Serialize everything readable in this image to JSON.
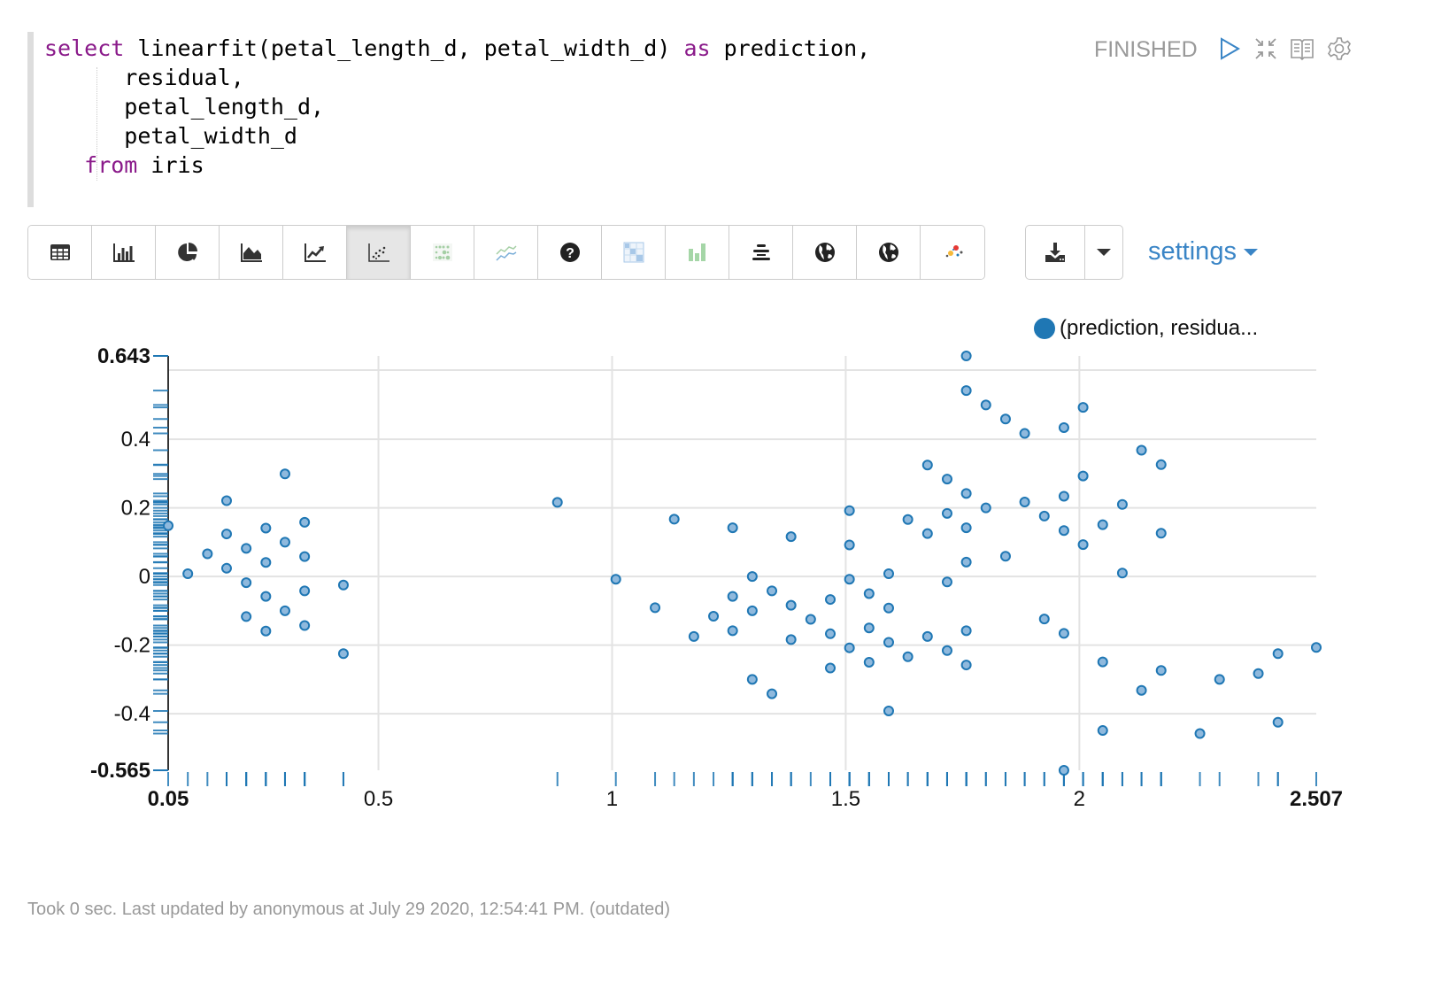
{
  "paragraph": {
    "code_lines": [
      [
        {
          "t": "select",
          "kw": true
        },
        {
          "t": " linearfit(petal_length_d, petal_width_d) "
        },
        {
          "t": "as",
          "kw": true
        },
        {
          "t": " prediction,"
        }
      ],
      [
        {
          "t": "      residual,"
        }
      ],
      [
        {
          "t": "      petal_length_d,"
        }
      ],
      [
        {
          "t": "      petal_width_d"
        }
      ],
      [
        {
          "t": "   "
        },
        {
          "t": "from",
          "kw": true
        },
        {
          "t": " iris"
        }
      ]
    ],
    "status": "FINISHED",
    "header_icons": [
      "run-icon",
      "collapse-icon",
      "book-icon",
      "gear-icon"
    ]
  },
  "toolbar": {
    "buttons": [
      {
        "name": "table-icon",
        "active": false
      },
      {
        "name": "bar-chart-icon",
        "active": false
      },
      {
        "name": "pie-chart-icon",
        "active": false
      },
      {
        "name": "area-chart-icon",
        "active": false
      },
      {
        "name": "line-chart-icon",
        "active": false
      },
      {
        "name": "scatter-chart-icon",
        "active": true
      },
      {
        "name": "bubble-grid-icon",
        "active": false
      },
      {
        "name": "multi-line-icon",
        "active": false
      },
      {
        "name": "help-icon",
        "active": false
      },
      {
        "name": "heatmap-icon",
        "active": false
      },
      {
        "name": "green-bar-icon",
        "active": false
      },
      {
        "name": "align-center-icon",
        "active": false
      },
      {
        "name": "globe-icon",
        "active": false
      },
      {
        "name": "globe-icon-2",
        "active": false
      },
      {
        "name": "color-scatter-icon",
        "active": false
      }
    ],
    "download_icon": "download-icon",
    "caret_icon": "caret-down-icon",
    "settings_label": "settings"
  },
  "colors": {
    "accent": "#1f77b4",
    "point_fill": "#8fb9dd",
    "point_stroke": "#1f77b4",
    "keyword": "#8a1a8a",
    "status": "#999999",
    "link": "#3a85c6"
  },
  "chart_data": {
    "type": "scatter",
    "title": "",
    "xlabel": "",
    "ylabel": "",
    "xlim": [
      0.05,
      2.507
    ],
    "ylim": [
      -0.565,
      0.643
    ],
    "x_ticks": [
      {
        "v": 0.05,
        "label": "0.05",
        "bold": true
      },
      {
        "v": 0.5,
        "label": "0.5"
      },
      {
        "v": 1,
        "label": "1"
      },
      {
        "v": 1.5,
        "label": "1.5"
      },
      {
        "v": 2,
        "label": "2"
      },
      {
        "v": 2.507,
        "label": "2.507",
        "bold": true
      }
    ],
    "y_ticks": [
      {
        "v": 0.643,
        "label": "0.643",
        "bold": true
      },
      {
        "v": 0.4,
        "label": "0.4"
      },
      {
        "v": 0.2,
        "label": "0.2"
      },
      {
        "v": 0,
        "label": "0"
      },
      {
        "v": -0.2,
        "label": "-0.2"
      },
      {
        "v": -0.4,
        "label": "-0.4"
      },
      {
        "v": -0.565,
        "label": "-0.565",
        "bold": true
      }
    ],
    "grid": true,
    "legend": {
      "label": "(prediction, residua...",
      "position": "top-right"
    },
    "series": [
      {
        "name": "(prediction, residual)",
        "points": [
          [
            0.05,
            0.148
          ],
          [
            0.092,
            0.008
          ],
          [
            0.134,
            0.066
          ],
          [
            0.175,
            0.221
          ],
          [
            0.175,
            0.124
          ],
          [
            0.175,
            0.024
          ],
          [
            0.217,
            0.082
          ],
          [
            0.217,
            -0.018
          ],
          [
            0.217,
            -0.117
          ],
          [
            0.259,
            0.141
          ],
          [
            0.259,
            0.041
          ],
          [
            0.259,
            -0.058
          ],
          [
            0.259,
            -0.159
          ],
          [
            0.3,
            0.299
          ],
          [
            0.3,
            0.1
          ],
          [
            0.3,
            -0.1
          ],
          [
            0.342,
            0.158
          ],
          [
            0.342,
            0.058
          ],
          [
            0.342,
            -0.042
          ],
          [
            0.342,
            -0.143
          ],
          [
            0.425,
            -0.025
          ],
          [
            0.425,
            -0.225
          ],
          [
            0.883,
            0.216
          ],
          [
            1.008,
            -0.008
          ],
          [
            1.092,
            -0.091
          ],
          [
            1.133,
            0.167
          ],
          [
            1.175,
            -0.175
          ],
          [
            1.217,
            -0.116
          ],
          [
            1.258,
            0.142
          ],
          [
            1.258,
            -0.058
          ],
          [
            1.258,
            -0.158
          ],
          [
            1.3,
            0.0
          ],
          [
            1.3,
            -0.1
          ],
          [
            1.3,
            -0.3
          ],
          [
            1.342,
            -0.042
          ],
          [
            1.342,
            -0.342
          ],
          [
            1.383,
            0.116
          ],
          [
            1.383,
            -0.084
          ],
          [
            1.383,
            -0.184
          ],
          [
            1.425,
            -0.125
          ],
          [
            1.467,
            -0.067
          ],
          [
            1.467,
            -0.167
          ],
          [
            1.467,
            -0.267
          ],
          [
            1.508,
            0.192
          ],
          [
            1.508,
            0.092
          ],
          [
            1.508,
            -0.008
          ],
          [
            1.508,
            -0.208
          ],
          [
            1.55,
            -0.05
          ],
          [
            1.55,
            -0.15
          ],
          [
            1.55,
            -0.25
          ],
          [
            1.592,
            0.008
          ],
          [
            1.592,
            -0.092
          ],
          [
            1.592,
            -0.192
          ],
          [
            1.592,
            -0.392
          ],
          [
            1.633,
            0.166
          ],
          [
            1.633,
            -0.234
          ],
          [
            1.675,
            0.325
          ],
          [
            1.675,
            0.125
          ],
          [
            1.675,
            -0.175
          ],
          [
            1.717,
            0.284
          ],
          [
            1.717,
            0.184
          ],
          [
            1.717,
            -0.016
          ],
          [
            1.717,
            -0.216
          ],
          [
            1.758,
            0.643
          ],
          [
            1.758,
            0.542
          ],
          [
            1.758,
            0.242
          ],
          [
            1.758,
            0.142
          ],
          [
            1.758,
            0.042
          ],
          [
            1.758,
            -0.158
          ],
          [
            1.758,
            -0.258
          ],
          [
            1.8,
            0.5
          ],
          [
            1.8,
            0.2
          ],
          [
            1.842,
            0.459
          ],
          [
            1.842,
            0.059
          ],
          [
            1.883,
            0.417
          ],
          [
            1.883,
            0.217
          ],
          [
            1.925,
            0.176
          ],
          [
            1.925,
            -0.124
          ],
          [
            1.967,
            0.434
          ],
          [
            1.967,
            0.234
          ],
          [
            1.967,
            0.134
          ],
          [
            1.967,
            -0.166
          ],
          [
            1.967,
            -0.565
          ],
          [
            2.008,
            0.493
          ],
          [
            2.008,
            0.293
          ],
          [
            2.008,
            0.093
          ],
          [
            2.05,
            0.151
          ],
          [
            2.05,
            -0.249
          ],
          [
            2.05,
            -0.449
          ],
          [
            2.092,
            0.21
          ],
          [
            2.092,
            0.01
          ],
          [
            2.133,
            0.368
          ],
          [
            2.133,
            -0.332
          ],
          [
            2.175,
            0.326
          ],
          [
            2.175,
            0.126
          ],
          [
            2.175,
            -0.274
          ],
          [
            2.258,
            -0.458
          ],
          [
            2.3,
            -0.3
          ],
          [
            2.383,
            -0.283
          ],
          [
            2.425,
            -0.225
          ],
          [
            2.425,
            -0.425
          ],
          [
            2.507,
            -0.207
          ]
        ]
      }
    ]
  },
  "footer": {
    "text": "Took 0 sec. Last updated by anonymous at July 29 2020, 12:54:41 PM. (outdated)"
  }
}
